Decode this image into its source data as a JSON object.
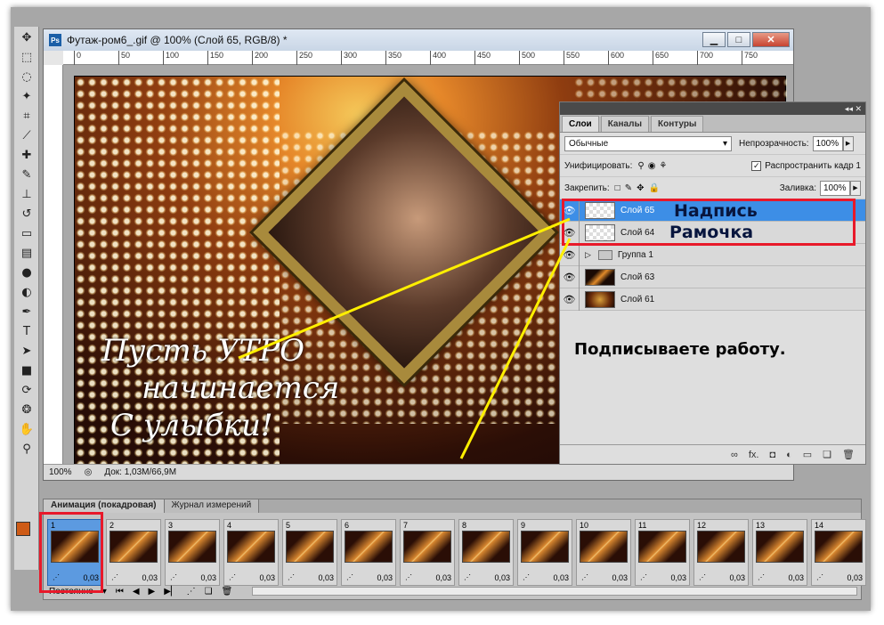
{
  "document": {
    "title": "Футаж-ром6_.gif @ 100% (Слой 65, RGB/8) *",
    "app_badge": "Ps",
    "zoom": "100%",
    "doc_size": "Док: 1,03M/66,9M",
    "ruler_ticks": [
      "0",
      "50",
      "100",
      "150",
      "200",
      "250",
      "300",
      "350",
      "400",
      "450",
      "500",
      "550",
      "600",
      "650",
      "700",
      "750"
    ]
  },
  "artwork_text": {
    "line1": "Пусть УТРО",
    "line2": "начинается",
    "line3": "С улыбки!"
  },
  "layers_panel": {
    "tabs": [
      "Слои",
      "Каналы",
      "Контуры"
    ],
    "blend_mode": "Обычные",
    "opacity_label": "Непрозрачность:",
    "opacity_value": "100%",
    "unify_label": "Унифицировать:",
    "propagate_label": "Распространить кадр 1",
    "lock_label": "Закрепить:",
    "fill_label": "Заливка:",
    "fill_value": "100%",
    "layers": [
      {
        "name": "Слой 65",
        "selected": true
      },
      {
        "name": "Слой 64",
        "selected": false
      },
      {
        "name": "Группа 1",
        "selected": false
      },
      {
        "name": "Слой 63",
        "selected": false
      },
      {
        "name": "Слой 61",
        "selected": false
      }
    ]
  },
  "annotations": {
    "label1": "Надпись",
    "label2": "Рамочка",
    "instruction": "Подписываете работу."
  },
  "animation_panel": {
    "tabs": [
      "Анимация (покадровая)",
      "Журнал измерений"
    ],
    "loop": "Постоянно",
    "frames": [
      {
        "n": "1",
        "delay": "0,03"
      },
      {
        "n": "2",
        "delay": "0,03"
      },
      {
        "n": "3",
        "delay": "0,03"
      },
      {
        "n": "4",
        "delay": "0,03"
      },
      {
        "n": "5",
        "delay": "0,03"
      },
      {
        "n": "6",
        "delay": "0,03"
      },
      {
        "n": "7",
        "delay": "0,03"
      },
      {
        "n": "8",
        "delay": "0,03"
      },
      {
        "n": "9",
        "delay": "0,03"
      },
      {
        "n": "10",
        "delay": "0,03"
      },
      {
        "n": "11",
        "delay": "0,03"
      },
      {
        "n": "12",
        "delay": "0,03"
      },
      {
        "n": "13",
        "delay": "0,03"
      },
      {
        "n": "14",
        "delay": "0,03"
      }
    ]
  },
  "colors": {
    "annotation_box": "#e8192a",
    "arrow": "#ffef00",
    "selection": "#3d8ee6",
    "foreground": "#ce5b16"
  }
}
